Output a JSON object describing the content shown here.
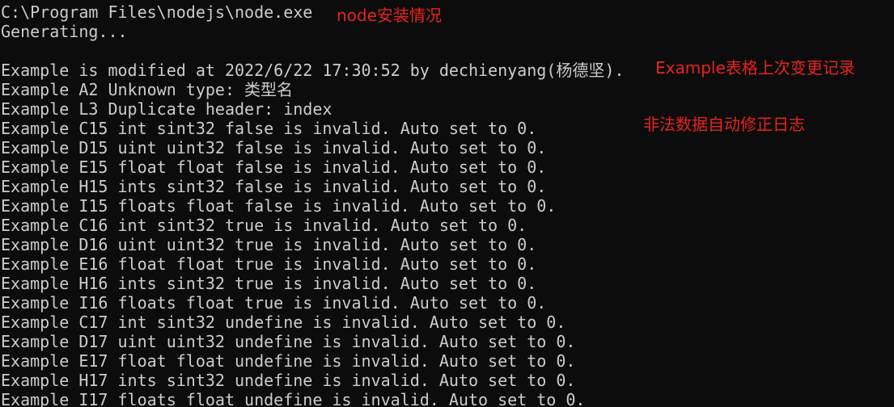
{
  "terminal": {
    "lines": [
      "C:\\Program Files\\nodejs\\node.exe",
      "Generating...",
      "",
      "Example is modified at 2022/6/22 17:30:52 by dechienyang(杨德坚).",
      "Example A2 Unknown type: 类型名",
      "Example L3 Duplicate header: index",
      "Example C15 int sint32 false is invalid. Auto set to 0.",
      "Example D15 uint uint32 false is invalid. Auto set to 0.",
      "Example E15 float float false is invalid. Auto set to 0.",
      "Example H15 ints sint32 false is invalid. Auto set to 0.",
      "Example I15 floats float false is invalid. Auto set to 0.",
      "Example C16 int sint32 true is invalid. Auto set to 0.",
      "Example D16 uint uint32 true is invalid. Auto set to 0.",
      "Example E16 float float true is invalid. Auto set to 0.",
      "Example H16 ints sint32 true is invalid. Auto set to 0.",
      "Example I16 floats float true is invalid. Auto set to 0.",
      "Example C17 int sint32 undefine is invalid. Auto set to 0.",
      "Example D17 uint uint32 undefine is invalid. Auto set to 0.",
      "Example E17 float float undefine is invalid. Auto set to 0.",
      "Example H17 ints sint32 undefine is invalid. Auto set to 0.",
      "Example I17 floats float undefine is invalid. Auto set to 0."
    ]
  },
  "annotations": {
    "node_install": "node安装情况",
    "example_change": "Example表格上次变更记录",
    "auto_fix_log": "非法数据自动修正日志"
  },
  "colors": {
    "background": "#0c0c0c",
    "text": "#cccccc",
    "annotation": "#e8231e"
  }
}
